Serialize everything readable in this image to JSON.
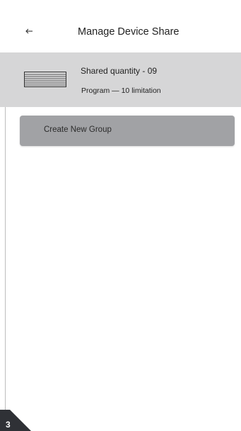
{
  "header": {
    "back_icon": "arrow-left-icon",
    "title": "Manage Device Share"
  },
  "device_card": {
    "icon": "device-panel-icon",
    "shared_quantity": "Shared quantity - 09",
    "program_limitation": "Program — 10 limitation"
  },
  "actions": {
    "create_group_label": "Create New Group"
  },
  "page_marker": {
    "number": "3"
  },
  "colors": {
    "card_background": "#d6d6d7",
    "button_background": "#a1a2a5",
    "badge": "#2f3136",
    "text": "#222222"
  }
}
